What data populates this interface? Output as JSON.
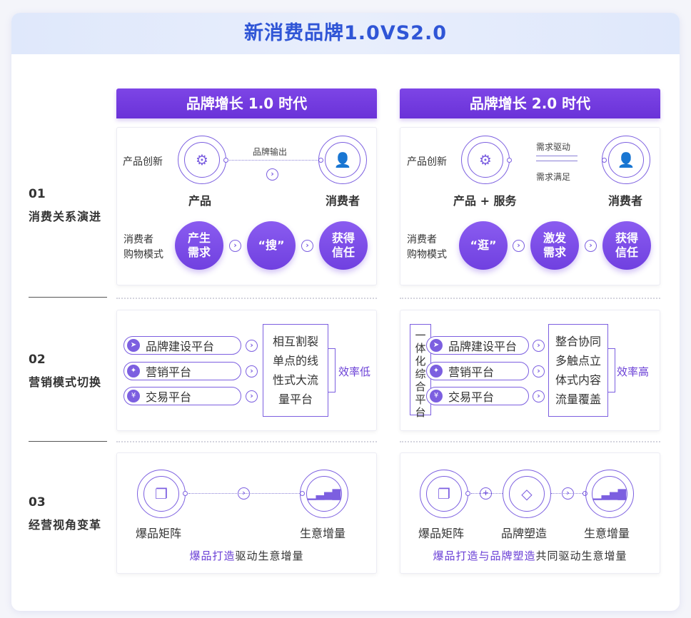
{
  "title": "新消费品牌1.0VS2.0",
  "eras": [
    {
      "label": "品牌增长 1.0 时代"
    },
    {
      "label": "品牌增长 2.0 时代"
    }
  ],
  "rows": [
    {
      "num": "01",
      "label": "消费关系演进"
    },
    {
      "num": "02",
      "label": "营销模式切换"
    },
    {
      "num": "03",
      "label": "经营视角变革"
    }
  ],
  "era1": {
    "r1": {
      "side_label": "产品创新",
      "left_node": "产品",
      "right_node": "消费者",
      "link_label": "品牌输出",
      "shop_label_1": "消费者",
      "shop_label_2": "购物模式",
      "steps": [
        {
          "l1": "产生",
          "l2": "需求"
        },
        {
          "l1": "“搜”",
          "l2": ""
        },
        {
          "l1": "获得",
          "l2": "信任"
        }
      ]
    },
    "r2": {
      "pills": [
        "品牌建设平台",
        "营销平台",
        "交易平台"
      ],
      "box_lines": [
        "相互割裂",
        "单点的线",
        "性式大流",
        "量平台"
      ],
      "efficiency": "效率低"
    },
    "r3": {
      "nodes": [
        "爆品矩阵",
        "生意增量"
      ],
      "caption_hl": "爆品打造",
      "caption_rest": "驱动生意增量"
    }
  },
  "era2": {
    "r1": {
      "side_label": "产品创新",
      "left_node": "产品 + 服务",
      "right_node": "消费者",
      "link_top": "需求驱动",
      "link_bottom": "需求满足",
      "shop_label_1": "消费者",
      "shop_label_2": "购物模式",
      "steps": [
        {
          "l1": "“逛”",
          "l2": ""
        },
        {
          "l1": "激发",
          "l2": "需求"
        },
        {
          "l1": "获得",
          "l2": "信任"
        }
      ]
    },
    "r2": {
      "vertical": [
        "一",
        "体",
        "化",
        "综",
        "合",
        "平",
        "台"
      ],
      "pills": [
        "品牌建设平台",
        "营销平台",
        "交易平台"
      ],
      "box_lines": [
        "整合协同",
        "多触点立",
        "体式内容",
        "流量覆盖"
      ],
      "efficiency": "效率高"
    },
    "r3": {
      "nodes": [
        "爆品矩阵",
        "品牌塑造",
        "生意增量"
      ],
      "caption_hl1": "爆品打造",
      "caption_mid": "与",
      "caption_hl2": "品牌塑造",
      "caption_rest": "共同驱动生意增量"
    }
  },
  "colors": {
    "accent": "#7040e0",
    "title": "#2f55d6"
  }
}
